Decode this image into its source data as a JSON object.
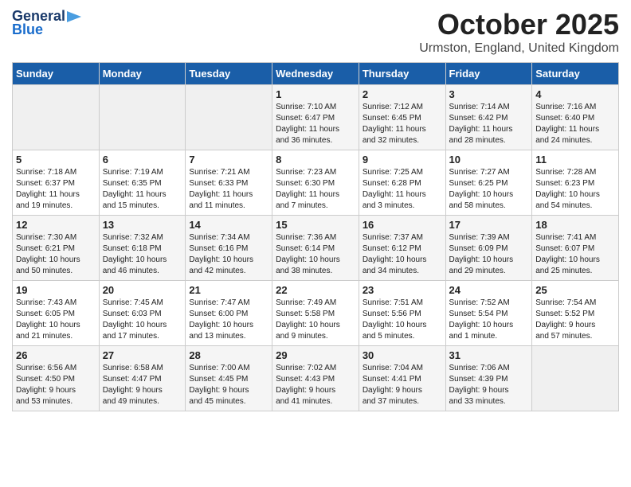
{
  "logo": {
    "line1": "General",
    "line2": "Blue"
  },
  "title": "October 2025",
  "subtitle": "Urmston, England, United Kingdom",
  "days_of_week": [
    "Sunday",
    "Monday",
    "Tuesday",
    "Wednesday",
    "Thursday",
    "Friday",
    "Saturday"
  ],
  "weeks": [
    [
      {
        "day": "",
        "info": ""
      },
      {
        "day": "",
        "info": ""
      },
      {
        "day": "",
        "info": ""
      },
      {
        "day": "1",
        "info": "Sunrise: 7:10 AM\nSunset: 6:47 PM\nDaylight: 11 hours\nand 36 minutes."
      },
      {
        "day": "2",
        "info": "Sunrise: 7:12 AM\nSunset: 6:45 PM\nDaylight: 11 hours\nand 32 minutes."
      },
      {
        "day": "3",
        "info": "Sunrise: 7:14 AM\nSunset: 6:42 PM\nDaylight: 11 hours\nand 28 minutes."
      },
      {
        "day": "4",
        "info": "Sunrise: 7:16 AM\nSunset: 6:40 PM\nDaylight: 11 hours\nand 24 minutes."
      }
    ],
    [
      {
        "day": "5",
        "info": "Sunrise: 7:18 AM\nSunset: 6:37 PM\nDaylight: 11 hours\nand 19 minutes."
      },
      {
        "day": "6",
        "info": "Sunrise: 7:19 AM\nSunset: 6:35 PM\nDaylight: 11 hours\nand 15 minutes."
      },
      {
        "day": "7",
        "info": "Sunrise: 7:21 AM\nSunset: 6:33 PM\nDaylight: 11 hours\nand 11 minutes."
      },
      {
        "day": "8",
        "info": "Sunrise: 7:23 AM\nSunset: 6:30 PM\nDaylight: 11 hours\nand 7 minutes."
      },
      {
        "day": "9",
        "info": "Sunrise: 7:25 AM\nSunset: 6:28 PM\nDaylight: 11 hours\nand 3 minutes."
      },
      {
        "day": "10",
        "info": "Sunrise: 7:27 AM\nSunset: 6:25 PM\nDaylight: 10 hours\nand 58 minutes."
      },
      {
        "day": "11",
        "info": "Sunrise: 7:28 AM\nSunset: 6:23 PM\nDaylight: 10 hours\nand 54 minutes."
      }
    ],
    [
      {
        "day": "12",
        "info": "Sunrise: 7:30 AM\nSunset: 6:21 PM\nDaylight: 10 hours\nand 50 minutes."
      },
      {
        "day": "13",
        "info": "Sunrise: 7:32 AM\nSunset: 6:18 PM\nDaylight: 10 hours\nand 46 minutes."
      },
      {
        "day": "14",
        "info": "Sunrise: 7:34 AM\nSunset: 6:16 PM\nDaylight: 10 hours\nand 42 minutes."
      },
      {
        "day": "15",
        "info": "Sunrise: 7:36 AM\nSunset: 6:14 PM\nDaylight: 10 hours\nand 38 minutes."
      },
      {
        "day": "16",
        "info": "Sunrise: 7:37 AM\nSunset: 6:12 PM\nDaylight: 10 hours\nand 34 minutes."
      },
      {
        "day": "17",
        "info": "Sunrise: 7:39 AM\nSunset: 6:09 PM\nDaylight: 10 hours\nand 29 minutes."
      },
      {
        "day": "18",
        "info": "Sunrise: 7:41 AM\nSunset: 6:07 PM\nDaylight: 10 hours\nand 25 minutes."
      }
    ],
    [
      {
        "day": "19",
        "info": "Sunrise: 7:43 AM\nSunset: 6:05 PM\nDaylight: 10 hours\nand 21 minutes."
      },
      {
        "day": "20",
        "info": "Sunrise: 7:45 AM\nSunset: 6:03 PM\nDaylight: 10 hours\nand 17 minutes."
      },
      {
        "day": "21",
        "info": "Sunrise: 7:47 AM\nSunset: 6:00 PM\nDaylight: 10 hours\nand 13 minutes."
      },
      {
        "day": "22",
        "info": "Sunrise: 7:49 AM\nSunset: 5:58 PM\nDaylight: 10 hours\nand 9 minutes."
      },
      {
        "day": "23",
        "info": "Sunrise: 7:51 AM\nSunset: 5:56 PM\nDaylight: 10 hours\nand 5 minutes."
      },
      {
        "day": "24",
        "info": "Sunrise: 7:52 AM\nSunset: 5:54 PM\nDaylight: 10 hours\nand 1 minute."
      },
      {
        "day": "25",
        "info": "Sunrise: 7:54 AM\nSunset: 5:52 PM\nDaylight: 9 hours\nand 57 minutes."
      }
    ],
    [
      {
        "day": "26",
        "info": "Sunrise: 6:56 AM\nSunset: 4:50 PM\nDaylight: 9 hours\nand 53 minutes."
      },
      {
        "day": "27",
        "info": "Sunrise: 6:58 AM\nSunset: 4:47 PM\nDaylight: 9 hours\nand 49 minutes."
      },
      {
        "day": "28",
        "info": "Sunrise: 7:00 AM\nSunset: 4:45 PM\nDaylight: 9 hours\nand 45 minutes."
      },
      {
        "day": "29",
        "info": "Sunrise: 7:02 AM\nSunset: 4:43 PM\nDaylight: 9 hours\nand 41 minutes."
      },
      {
        "day": "30",
        "info": "Sunrise: 7:04 AM\nSunset: 4:41 PM\nDaylight: 9 hours\nand 37 minutes."
      },
      {
        "day": "31",
        "info": "Sunrise: 7:06 AM\nSunset: 4:39 PM\nDaylight: 9 hours\nand 33 minutes."
      },
      {
        "day": "",
        "info": ""
      }
    ]
  ]
}
